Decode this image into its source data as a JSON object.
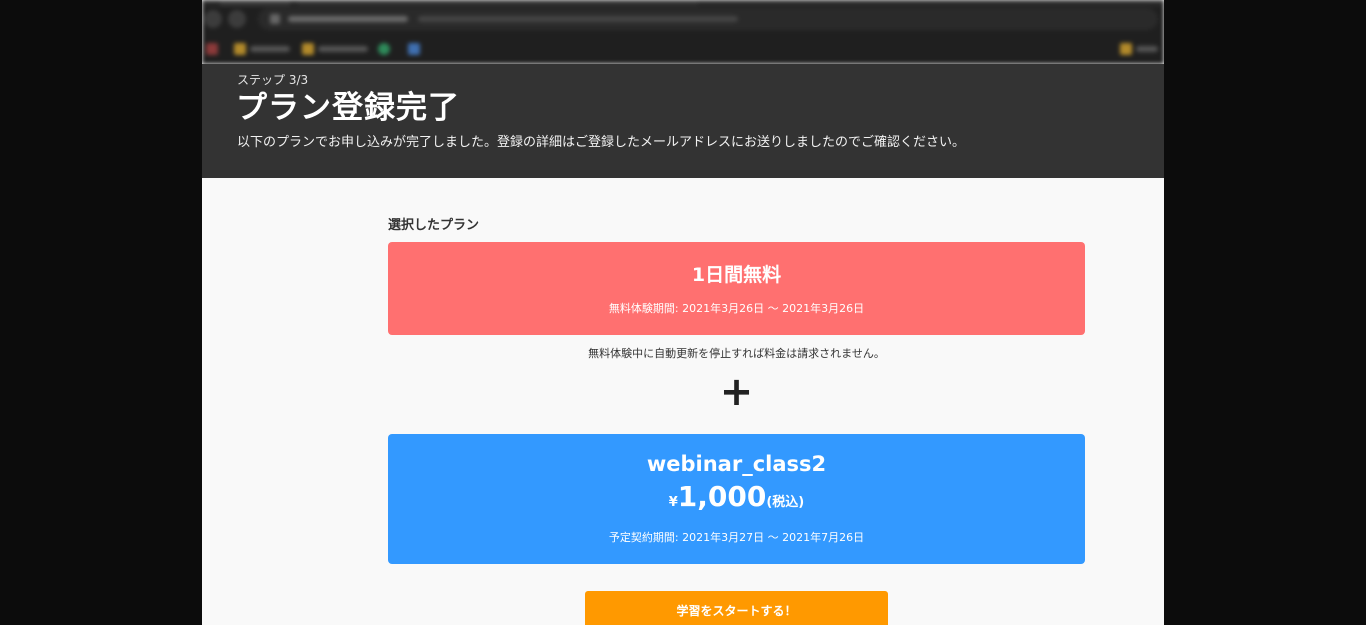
{
  "header": {
    "step": "ステップ 3/3",
    "title": "プラン登録完了",
    "description": "以下のプランでお申し込みが完了しました。登録の詳細はご登録したメールアドレスにお送りしましたのでご確認ください。"
  },
  "selected_plans": {
    "label": "選択したプラン",
    "free_plan": {
      "name": "1日間無料",
      "period": "無料体験期間: 2021年3月26日 〜 2021年3月26日"
    },
    "notice": "無料体験中に自動更新を停止すれば料金は請求されません。",
    "plus": "+",
    "paid_plan": {
      "name": "webinar_class2",
      "currency": "¥",
      "price": "1,000",
      "tax_note": "(税込)",
      "period": "予定契約期間: 2021年3月27日 〜 2021年7月26日"
    }
  },
  "actions": {
    "start_label": "学習をスタートする！"
  },
  "colors": {
    "hero_bg": "#333333",
    "free_card": "#ff7070",
    "paid_card": "#3399ff",
    "start_button": "#ff9900"
  }
}
